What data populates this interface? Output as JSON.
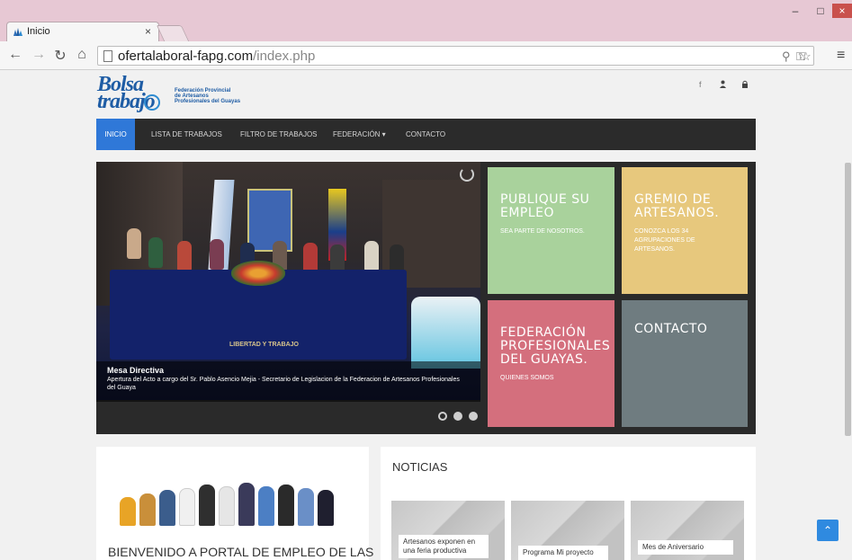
{
  "browser": {
    "tab_title": "Inicio",
    "tab_close": "×",
    "url_domain": "ofertalaboral-fapg.com",
    "url_path": "/index.php",
    "window_min": "–",
    "window_max": "□",
    "window_close": "×"
  },
  "header": {
    "logo_line1": "Bolsa",
    "logo_line2": "trabajo",
    "logo_subtitle": [
      "Federación Provincial",
      "de Artesanos",
      "Profesionales del Guayas"
    ],
    "social": [
      "f",
      "👤",
      "🔒"
    ]
  },
  "nav": {
    "items": [
      "INICIO",
      "LISTA DE TRABAJOS",
      "FILTRO DE TRABAJOS",
      "FEDERACIÓN ▾",
      "CONTACTO"
    ],
    "active_index": 0
  },
  "slider": {
    "caption_title": "Mesa Directiva",
    "caption_text": "Apertura del Acto a cargo del Sr. Pablo Asencio Mejia - Secretario de Legislacion de la Federacion de Artesanos Profesionales del Guaya",
    "banner_text": "LIBERTAD Y TRABAJO",
    "slide_count": 3,
    "active_slide": 0
  },
  "tiles": [
    {
      "title": "PUBLIQUE SU EMPLEO",
      "subtitle": "SEA PARTE DE NOSOTROS.",
      "color": "#a9d29c"
    },
    {
      "title": "GREMIO DE ARTESANOS.",
      "subtitle": "CONOZCA LOS 34 AGRUPACIONES DE ARTESANOS.",
      "color": "#e7c87d"
    },
    {
      "title": "FEDERACIÓN PROFESIONALES DEL GUAYAS.",
      "subtitle": "QUIENES SOMOS",
      "color": "#d46f7d"
    },
    {
      "title": "CONTACTO",
      "subtitle": "",
      "color": "#6f7c80"
    }
  ],
  "welcome": {
    "title": "BIENVENIDO A PORTAL DE EMPLEO DE LAS"
  },
  "news": {
    "title": "NOTICIAS",
    "items": [
      "Artesanos exponen en una feria productiva",
      "Programa Mi proyecto",
      "Mes de Aniversario"
    ]
  },
  "back_to_top": "⌃",
  "colors": {
    "accent": "#2f78d8",
    "navbar": "#2b2b2b"
  }
}
